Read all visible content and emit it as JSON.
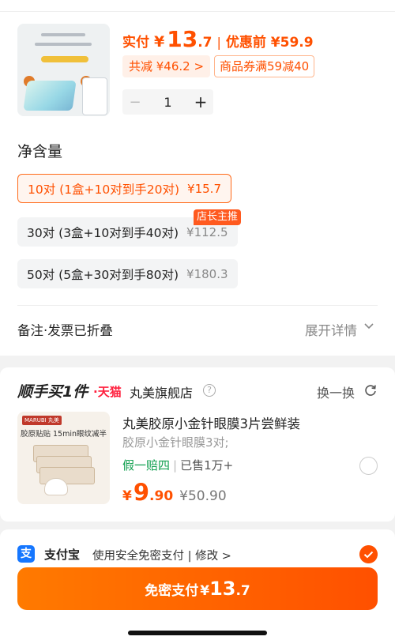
{
  "product": {
    "paid_label": "实付",
    "paid_yen": "¥",
    "paid_int": "13",
    "paid_dec": ".7",
    "separator": "|",
    "pre_discount": "优惠前 ¥59.9",
    "discount_tag": "共减 ¥46.2 >",
    "coupon_tag": "商品券满59减40",
    "quantity": "1",
    "minus": "−",
    "plus": "+"
  },
  "spec": {
    "title": "净含量",
    "variants": [
      {
        "name": "10对 (1盒+10对到手20对)",
        "price": "¥15.7",
        "selected": true
      },
      {
        "name": "30对 (3盒+10对到手40对)",
        "price": "¥112.5",
        "selected": false
      },
      {
        "name": "50对 (5盒+30对到手80对)",
        "price": "¥180.3",
        "selected": false
      }
    ],
    "owner_badge": "店长主推"
  },
  "notes": {
    "label": "备注·发票已折叠",
    "expand": "展开详情"
  },
  "addon": {
    "title": "顺手买1件",
    "tmall": "·天猫",
    "store": "丸美旗舰店",
    "help": "?",
    "swap": "换一换",
    "item": {
      "title": "丸美胶原小金针眼膜3片尝鲜装",
      "subtitle": "胶原小金针眼膜3对;",
      "tag1": "假一赔四",
      "tag_sep": "|",
      "tag2": "已售1万+",
      "price_yen": "¥",
      "price_int": "9",
      "price_dec": ".90",
      "original": "¥50.90",
      "image_brand": "MARUBI 丸美",
      "image_caption": "胶原贴贴 15min眼纹减半"
    }
  },
  "payment": {
    "method": "支付宝",
    "icon_glyph": "支",
    "desc": "使用安全免密支付 | 修改 >",
    "button_label": "免密支付",
    "button_yen": "¥",
    "button_int": "13",
    "button_dec": ".7"
  },
  "colors": {
    "accent": "#ff5000",
    "alipay": "#1677ff",
    "tmall": "#ff1f3d",
    "green": "#12a050"
  }
}
